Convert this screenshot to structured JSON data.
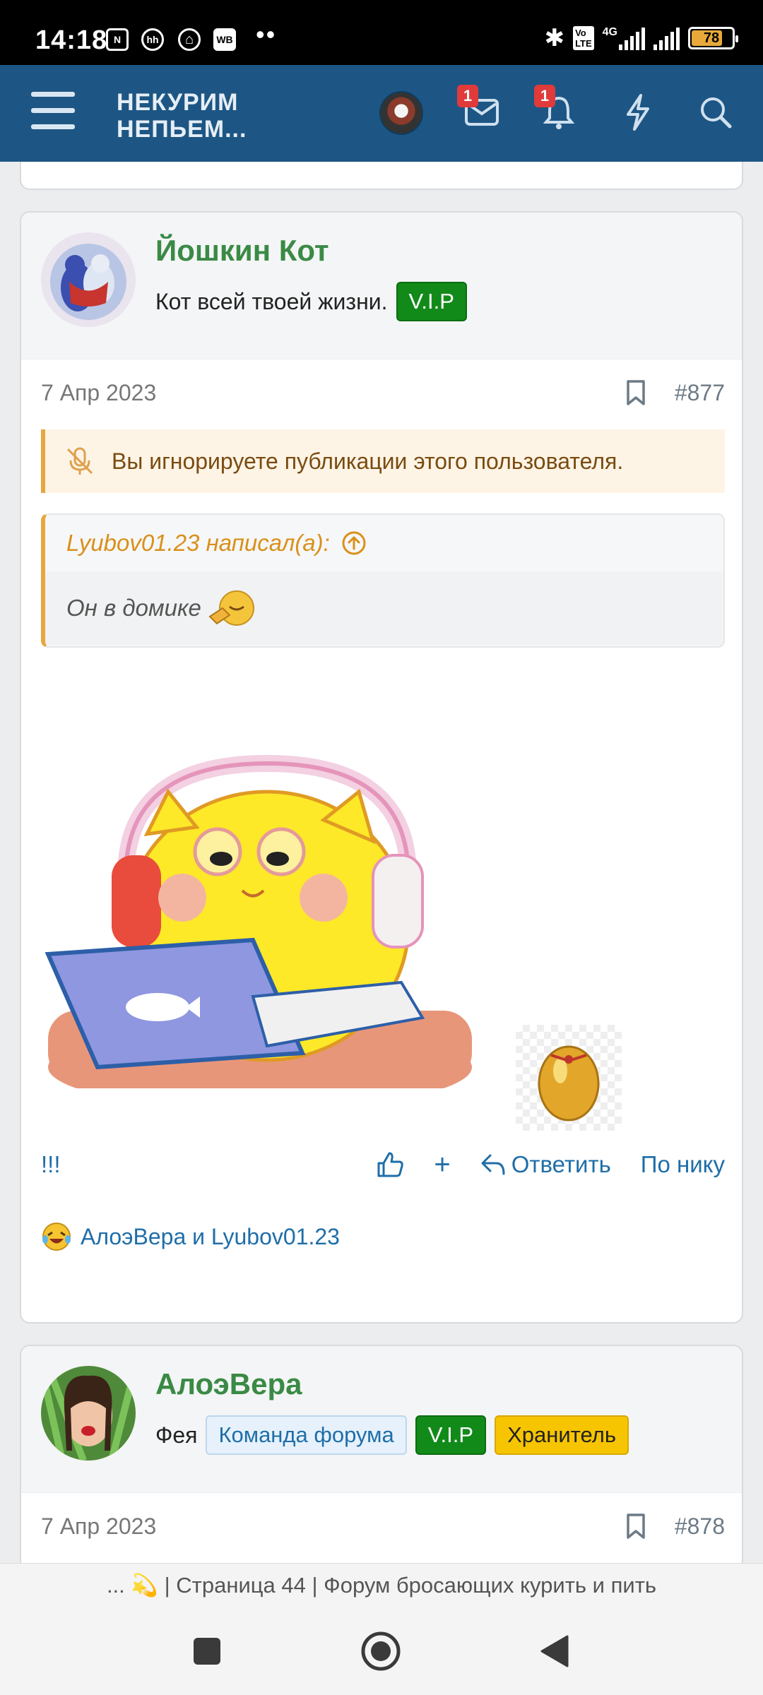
{
  "status_bar": {
    "time": "14:18",
    "notif_icons": [
      "N",
      "hh",
      "WB"
    ],
    "battery": "78",
    "network": "4G"
  },
  "header": {
    "logo_line1": "НЕКУРИМ",
    "logo_line2": "НЕПЬЕМ...",
    "messages_badge": "1",
    "alerts_badge": "1"
  },
  "posts": [
    {
      "username": "Йошкин Кот",
      "user_title": "Кот всей твоей жизни.",
      "tags": [
        "V.I.P"
      ],
      "date": "7 Апр 2023",
      "post_number": "#877",
      "ignore_notice": "Вы игнорируете публикации этого пользователя.",
      "quote_author": "Lyubov01.23 написал(а):",
      "quote_text": "Он в домике",
      "actions": {
        "left": "!!!",
        "like": "like",
        "plus": "+",
        "reply": "Ответить",
        "by_nick": "По нику"
      },
      "reactions_text": "АлоэВера и Lyubov01.23"
    },
    {
      "username": "АлоэВера",
      "user_title": "Фея",
      "tags": [
        "Команда форума",
        "V.I.P",
        "Хранитель"
      ],
      "date": "7 Апр 2023",
      "post_number": "#878"
    }
  ],
  "page_title": "... 💫 | Страница 44 | Форум бросающих курить и пить",
  "colors": {
    "header_bg": "#1d5684",
    "username": "#3a8a45",
    "vip": "#128a19",
    "quote_accent": "#e8a640",
    "link": "#1f6ea8"
  }
}
